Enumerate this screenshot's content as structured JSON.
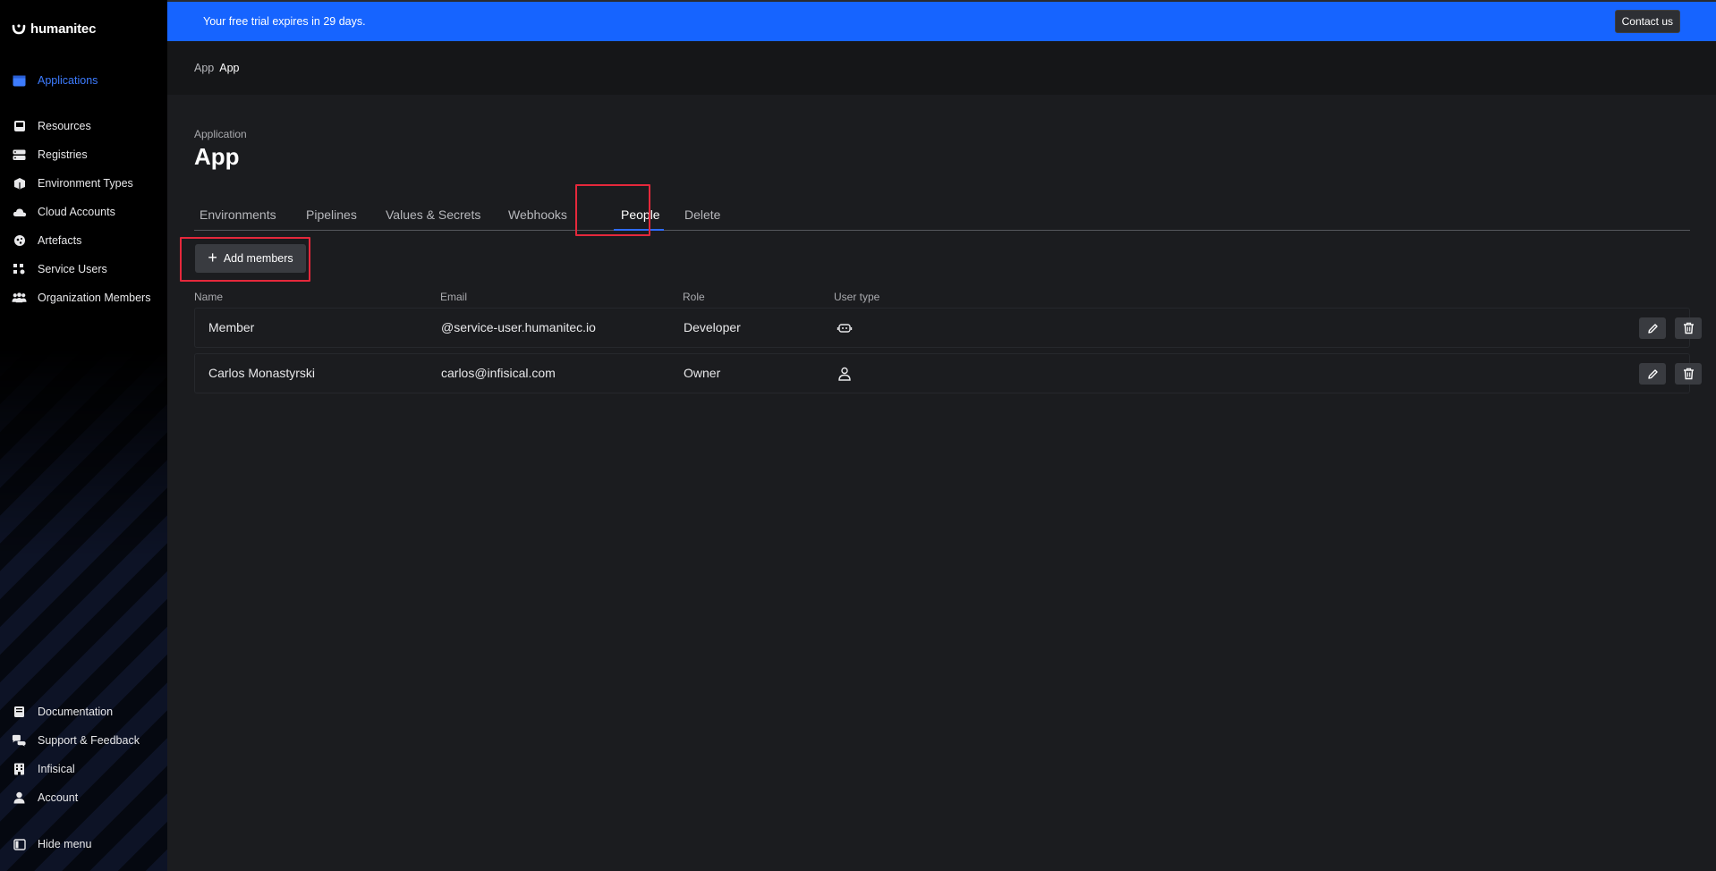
{
  "sidebar": {
    "brand": "humanitec",
    "items": [
      {
        "label": "Applications",
        "icon": "applications-icon"
      },
      {
        "label": "Resources",
        "icon": "resources-icon"
      },
      {
        "label": "Registries",
        "icon": "registries-icon"
      },
      {
        "label": "Environment Types",
        "icon": "environment-types-icon"
      },
      {
        "label": "Cloud Accounts",
        "icon": "cloud-accounts-icon"
      },
      {
        "label": "Artefacts",
        "icon": "artefacts-icon"
      },
      {
        "label": "Service Users",
        "icon": "service-users-icon"
      },
      {
        "label": "Organization Members",
        "icon": "organization-members-icon"
      }
    ],
    "bottom_items": [
      {
        "label": "Documentation",
        "icon": "documentation-icon"
      },
      {
        "label": "Support & Feedback",
        "icon": "support-icon"
      },
      {
        "label": "Infisical",
        "icon": "organization-icon"
      },
      {
        "label": "Account",
        "icon": "account-icon"
      },
      {
        "label": "Hide menu",
        "icon": "hide-menu-icon"
      }
    ],
    "active_color": "#3d7cff"
  },
  "banner": {
    "text": "Your free trial expires in 29 days.",
    "contact_label": "Contact us",
    "color": "#1664ff"
  },
  "breadcrumb": {
    "first": "App",
    "second": "App"
  },
  "page": {
    "kicker": "Application",
    "title": "App"
  },
  "tabs": [
    "Environments",
    "Pipelines",
    "Values & Secrets",
    "Webhooks",
    "People",
    "Delete"
  ],
  "active_tab": "People",
  "add_members_label": "Add members",
  "table": {
    "headers": [
      "Name",
      "Email",
      "Role",
      "User type"
    ],
    "rows": [
      {
        "name": "Member",
        "email": "@service-user.humanitec.io",
        "role": "Developer",
        "user_type_icon": "robot-icon"
      },
      {
        "name": "Carlos Monastyrski",
        "email": "carlos@infisical.com",
        "role": "Owner",
        "user_type_icon": "person-icon"
      }
    ]
  },
  "highlight_color": "#e5283b"
}
